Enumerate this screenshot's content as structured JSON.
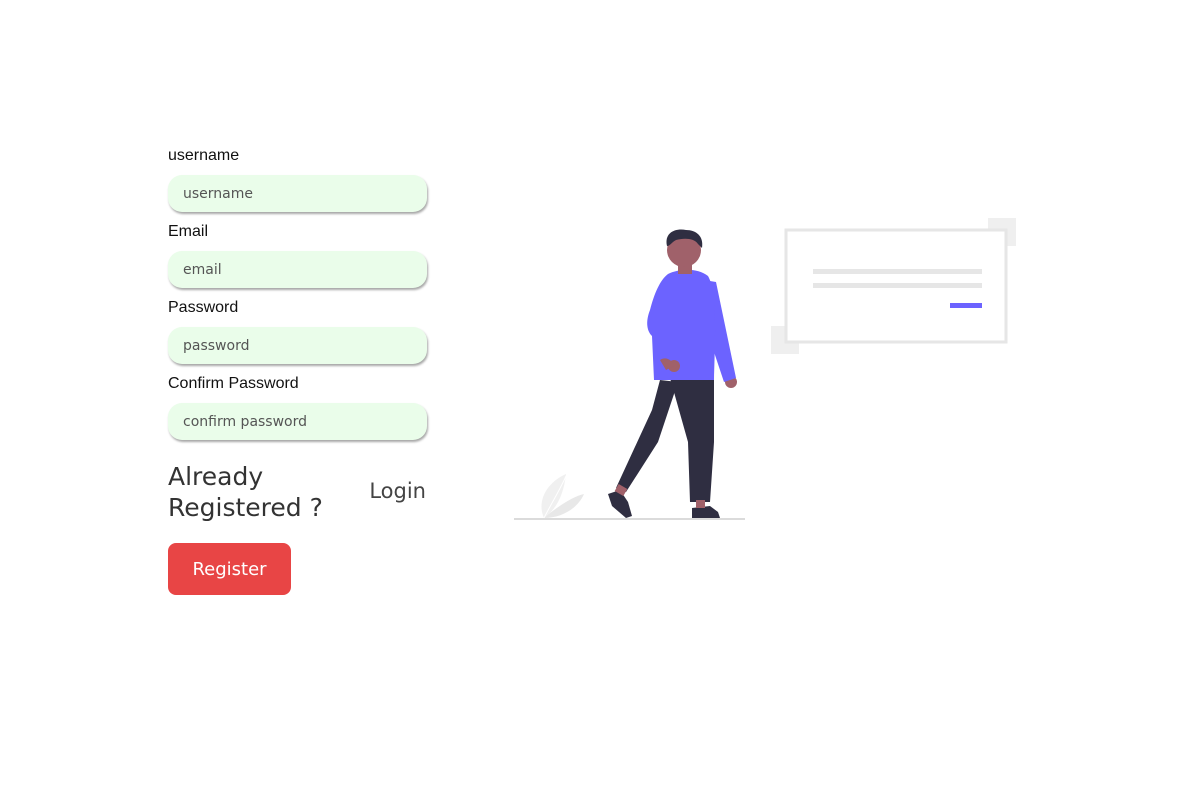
{
  "form": {
    "fields": [
      {
        "label": "username",
        "placeholder": "username",
        "value": ""
      },
      {
        "label": "Email",
        "placeholder": "email",
        "value": ""
      },
      {
        "label": "Password",
        "placeholder": "password",
        "value": ""
      },
      {
        "label": "Confirm Password",
        "placeholder": "confirm password",
        "value": ""
      }
    ],
    "already_registered_text": "Already Registered ?",
    "login_link": "Login",
    "register_button": "Register"
  },
  "colors": {
    "input_background": "#eafdea",
    "register_button": "#e84545",
    "accent": "#6c63ff",
    "figure_pants": "#2f2e41",
    "skin": "#a0616a"
  },
  "illustration": {
    "name": "person-walking-with-message-card",
    "icons": [
      "person-figure",
      "message-card",
      "leaf-plant"
    ]
  }
}
